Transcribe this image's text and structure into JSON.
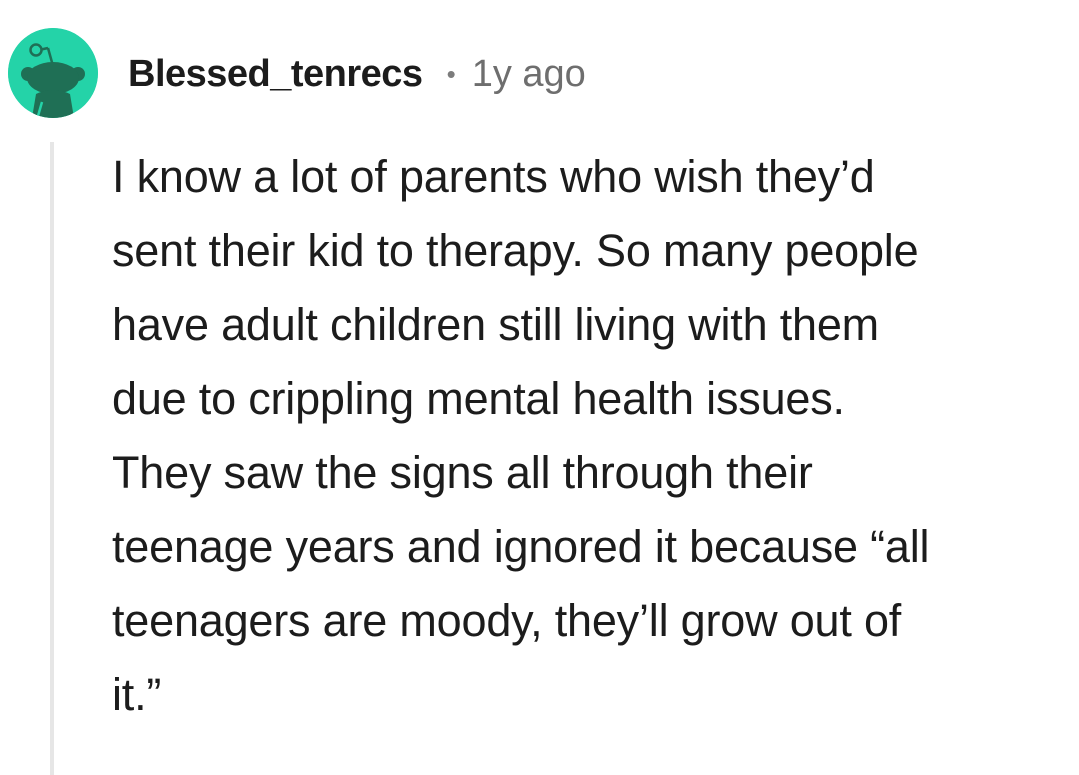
{
  "comment": {
    "author": "Blessed_tenrecs",
    "separator": "•",
    "timestamp": "1y ago",
    "avatar_icon": "snoo-avatar-icon",
    "avatar_color": "#24d3a8",
    "body_lines": [
      "I know a lot of parents who wish they’d",
      "sent their kid to therapy. So many people",
      "have adult children still living with them",
      "due to crippling mental health issues.",
      "They saw the signs all through their",
      "teenage years and ignored it because “all",
      "teenagers are moody, they’ll grow out of",
      "it.”"
    ]
  }
}
